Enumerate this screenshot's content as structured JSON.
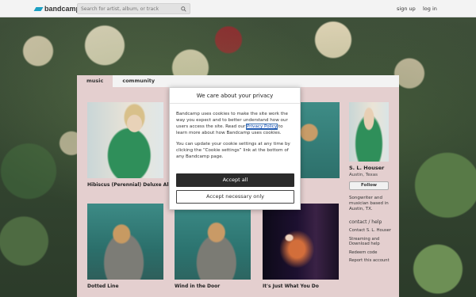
{
  "header": {
    "logo_text": "bandcamp",
    "search_placeholder": "Search for artist, album, or track",
    "signup_label": "sign up",
    "login_label": "log in"
  },
  "tabs": [
    {
      "label": "music",
      "active": true
    },
    {
      "label": "community",
      "active": false
    }
  ],
  "albums": [
    {
      "title": "Hibiscus (Perennial) Deluxe Album"
    },
    {
      "title": "Dotted Line"
    },
    {
      "title": "Wind in the Door"
    },
    {
      "title": "It's Just What You Do"
    }
  ],
  "artist": {
    "name": "S. L. Houser",
    "location": "Austin, Texas",
    "follow_label": "Follow",
    "bio": "Songwriter and musician based in Austin, TX.",
    "contact_heading": "contact / help",
    "links": [
      "Contact S. L. Houser",
      "Streaming and Download help",
      "Redeem code",
      "Report this account"
    ]
  },
  "cookie_dialog": {
    "title": "We care about your privacy",
    "para1_before": "Bandcamp uses cookies to make the site work the way you expect and to better understand how our users access the site. Read our ",
    "privacy_link": "Privacy Policy",
    "para1_after": " to learn more about how Bandcamp uses cookies.",
    "para2": "You can update your cookie settings at any time by clicking the “Cookie settings” link at the bottom of any Bandcamp page.",
    "accept_all_label": "Accept all",
    "accept_necessary_label": "Accept necessary only"
  },
  "colors": {
    "accent": "#1da0c3",
    "panel_bg": "#e4cfcf",
    "button_dark": "#2b2b2b"
  }
}
